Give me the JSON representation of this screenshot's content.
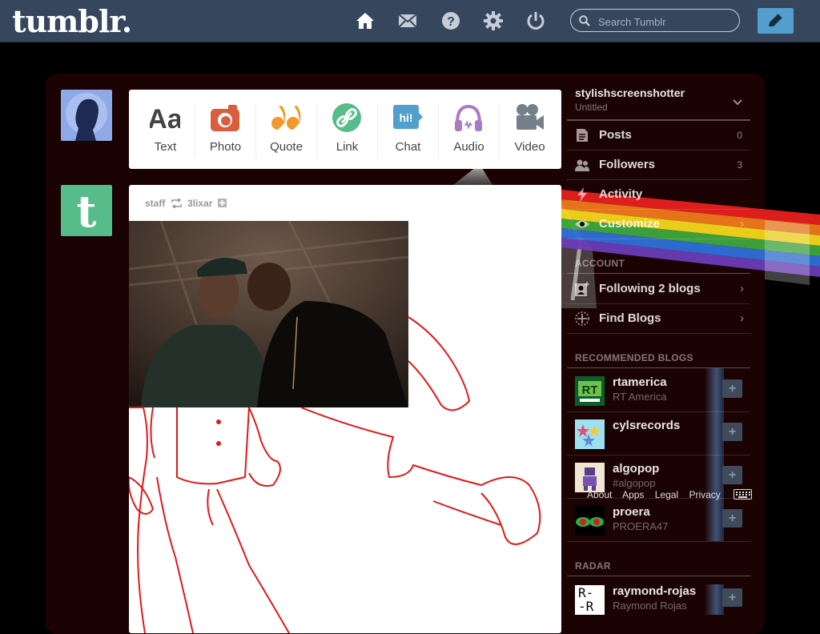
{
  "header": {
    "logo": "tumblr.",
    "search_placeholder": "Search Tumblr",
    "nav_icons": [
      "home-icon",
      "mail-icon",
      "help-icon",
      "gear-icon",
      "power-icon"
    ],
    "compose_icon": "pencil-icon"
  },
  "post_types": [
    {
      "label": "Text",
      "icon": "text-icon",
      "color": "#444444"
    },
    {
      "label": "Photo",
      "icon": "camera-icon",
      "color": "#d95e40"
    },
    {
      "label": "Quote",
      "icon": "quote-icon",
      "color": "#f2992e"
    },
    {
      "label": "Link",
      "icon": "link-icon",
      "color": "#56bc8a"
    },
    {
      "label": "Chat",
      "icon": "chat-icon",
      "color": "#529ecc"
    },
    {
      "label": "Audio",
      "icon": "headphones-icon",
      "color": "#a77dc2"
    },
    {
      "label": "Video",
      "icon": "video-camera-icon",
      "color": "#748089"
    }
  ],
  "post": {
    "author": "staff",
    "reblogged_from": "3lixar",
    "reblog_icon": "reblog-icon",
    "follow_icon": "plus-icon"
  },
  "sidebar": {
    "blog_name": "stylishscreenshotter",
    "blog_title": "Untitled",
    "menu": [
      {
        "label": "Posts",
        "count": "0",
        "icon": "posts-icon"
      },
      {
        "label": "Followers",
        "count": "3",
        "icon": "followers-icon"
      },
      {
        "label": "Activity",
        "icon": "lightning-icon"
      },
      {
        "label": "Customize",
        "icon": "eye-icon"
      }
    ],
    "account_heading": "ACCOUNT",
    "account_items": [
      {
        "label": "Following 2 blogs",
        "icon": "following-icon"
      },
      {
        "label": "Find Blogs",
        "icon": "compass-icon"
      }
    ],
    "recommended_heading": "RECOMMENDED BLOGS",
    "recommended": [
      {
        "name": "rtamerica",
        "sub": "RT America"
      },
      {
        "name": "cylsrecords",
        "sub": ""
      },
      {
        "name": "algopop",
        "sub": "#algopop"
      },
      {
        "name": "proera",
        "sub": "PROERA47"
      }
    ],
    "footer_links": [
      "About",
      "Apps",
      "Legal",
      "Privacy"
    ],
    "radar_heading": "RADAR",
    "radar": [
      {
        "name": "raymond-rojas",
        "sub": "Raymond Rojas",
        "thumb_text": "R-\n-R"
      }
    ],
    "rt_thumb_text": "RT"
  },
  "colors": {
    "header_bg": "#36465d",
    "compose_bg": "#529ecc",
    "dashboard_bg": "#1c0303",
    "drawing_stroke": "#e0191b"
  }
}
